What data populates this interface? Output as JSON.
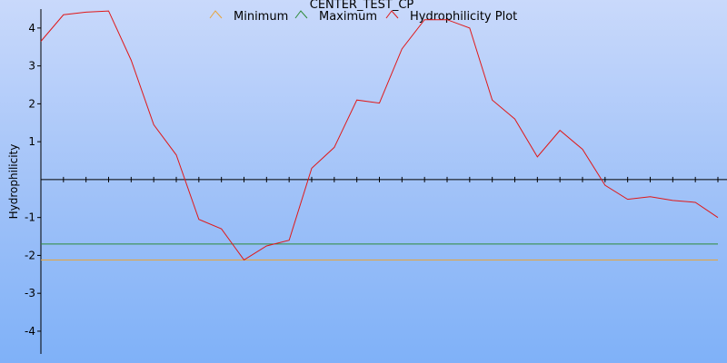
{
  "chart_data": {
    "type": "line",
    "title": "CENTER_TEST_CP",
    "ylabel": "Hydrophilicity",
    "xlabel": "",
    "ylim": [
      -4.6,
      4.5
    ],
    "yticks": [
      4,
      3,
      2,
      1,
      -1,
      -2,
      -3,
      -4
    ],
    "grid": false,
    "legend": "top",
    "series": [
      {
        "name": "Minimum",
        "color": "#e8a33a",
        "values": [
          -2.12,
          -2.12
        ]
      },
      {
        "name": "Maximum",
        "color": "#2e8b3a",
        "values": [
          -1.7,
          -1.7
        ]
      },
      {
        "name": "Hydrophilicity Plot",
        "color": "#e01818",
        "values": [
          3.65,
          4.35,
          4.42,
          4.45,
          3.15,
          1.45,
          0.65,
          -1.05,
          -1.3,
          -2.12,
          -1.75,
          -1.6,
          0.3,
          0.85,
          2.1,
          2.02,
          3.45,
          4.22,
          4.22,
          4.0,
          2.1,
          1.6,
          0.6,
          1.3,
          0.8,
          -0.15,
          -0.52,
          -0.45,
          -0.55,
          -0.6,
          -1.0
        ]
      }
    ]
  }
}
